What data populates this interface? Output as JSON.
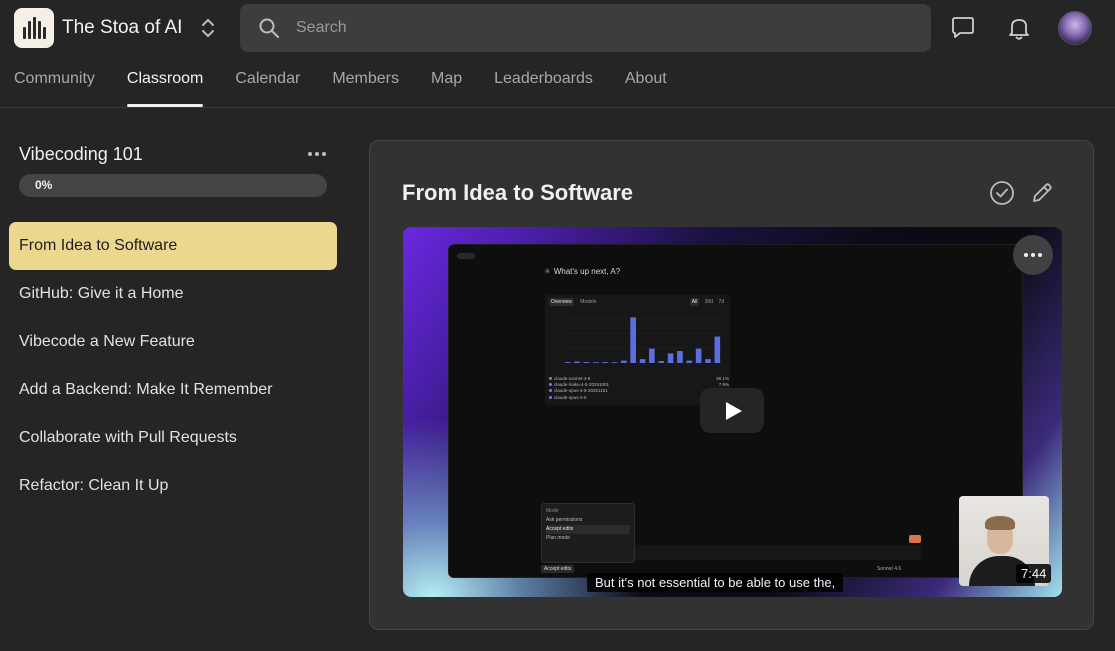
{
  "header": {
    "community_name": "The Stoa of AI",
    "search_placeholder": "Search",
    "tabs": [
      {
        "label": "Community"
      },
      {
        "label": "Classroom"
      },
      {
        "label": "Calendar"
      },
      {
        "label": "Members"
      },
      {
        "label": "Map"
      },
      {
        "label": "Leaderboards"
      },
      {
        "label": "About"
      }
    ],
    "active_tab": "Classroom"
  },
  "sidebar": {
    "course_title": "Vibecoding 101",
    "progress_text": "0%",
    "progress_fraction": 0,
    "lessons": [
      {
        "label": "From Idea to Software"
      },
      {
        "label": "GitHub: Give it a Home"
      },
      {
        "label": "Vibecode a New Feature"
      },
      {
        "label": "Add a Backend: Make It Remember"
      },
      {
        "label": "Collaborate with Pull Requests"
      },
      {
        "label": "Refactor: Clean It Up"
      }
    ],
    "active_lesson": "From Idea to Software"
  },
  "main": {
    "lesson_title": "From Idea to Software",
    "video": {
      "caption": "But it's not essential to be able to use the,",
      "duration": "7:44",
      "inner_screen": {
        "prompt": "What's up next, A?",
        "tabs_left": [
          "Overview",
          "Models"
        ],
        "tabs_right": [
          "All",
          "30d",
          "7d"
        ],
        "chart_bars": [
          0.02,
          0.03,
          0.02,
          0.01,
          0.02,
          0.01,
          0.05,
          0.95,
          0.08,
          0.3,
          0.04,
          0.2,
          0.25,
          0.05,
          0.3,
          0.08,
          0.55
        ],
        "legend": [
          {
            "name": "claude-sonnet-4-6",
            "value": "90.1%"
          },
          {
            "name": "claude-haiku-4-5-20251001",
            "value": "7.9%"
          },
          {
            "name": "claude-opus-4-5-20251101",
            "value": ""
          },
          {
            "name": "claude-opus-4-6",
            "value": ""
          }
        ],
        "mode_menu": {
          "header": "Mode",
          "items": [
            "Ask permissions",
            "Accept edits",
            "Plan mode"
          ],
          "selected": "Accept edits"
        },
        "bottom_chip": "Accept edits",
        "bottom_right": "Sonnet 4.6"
      }
    }
  },
  "colors": {
    "background": "#252525",
    "active_lesson": "#ecd78f",
    "card": "#323232"
  }
}
